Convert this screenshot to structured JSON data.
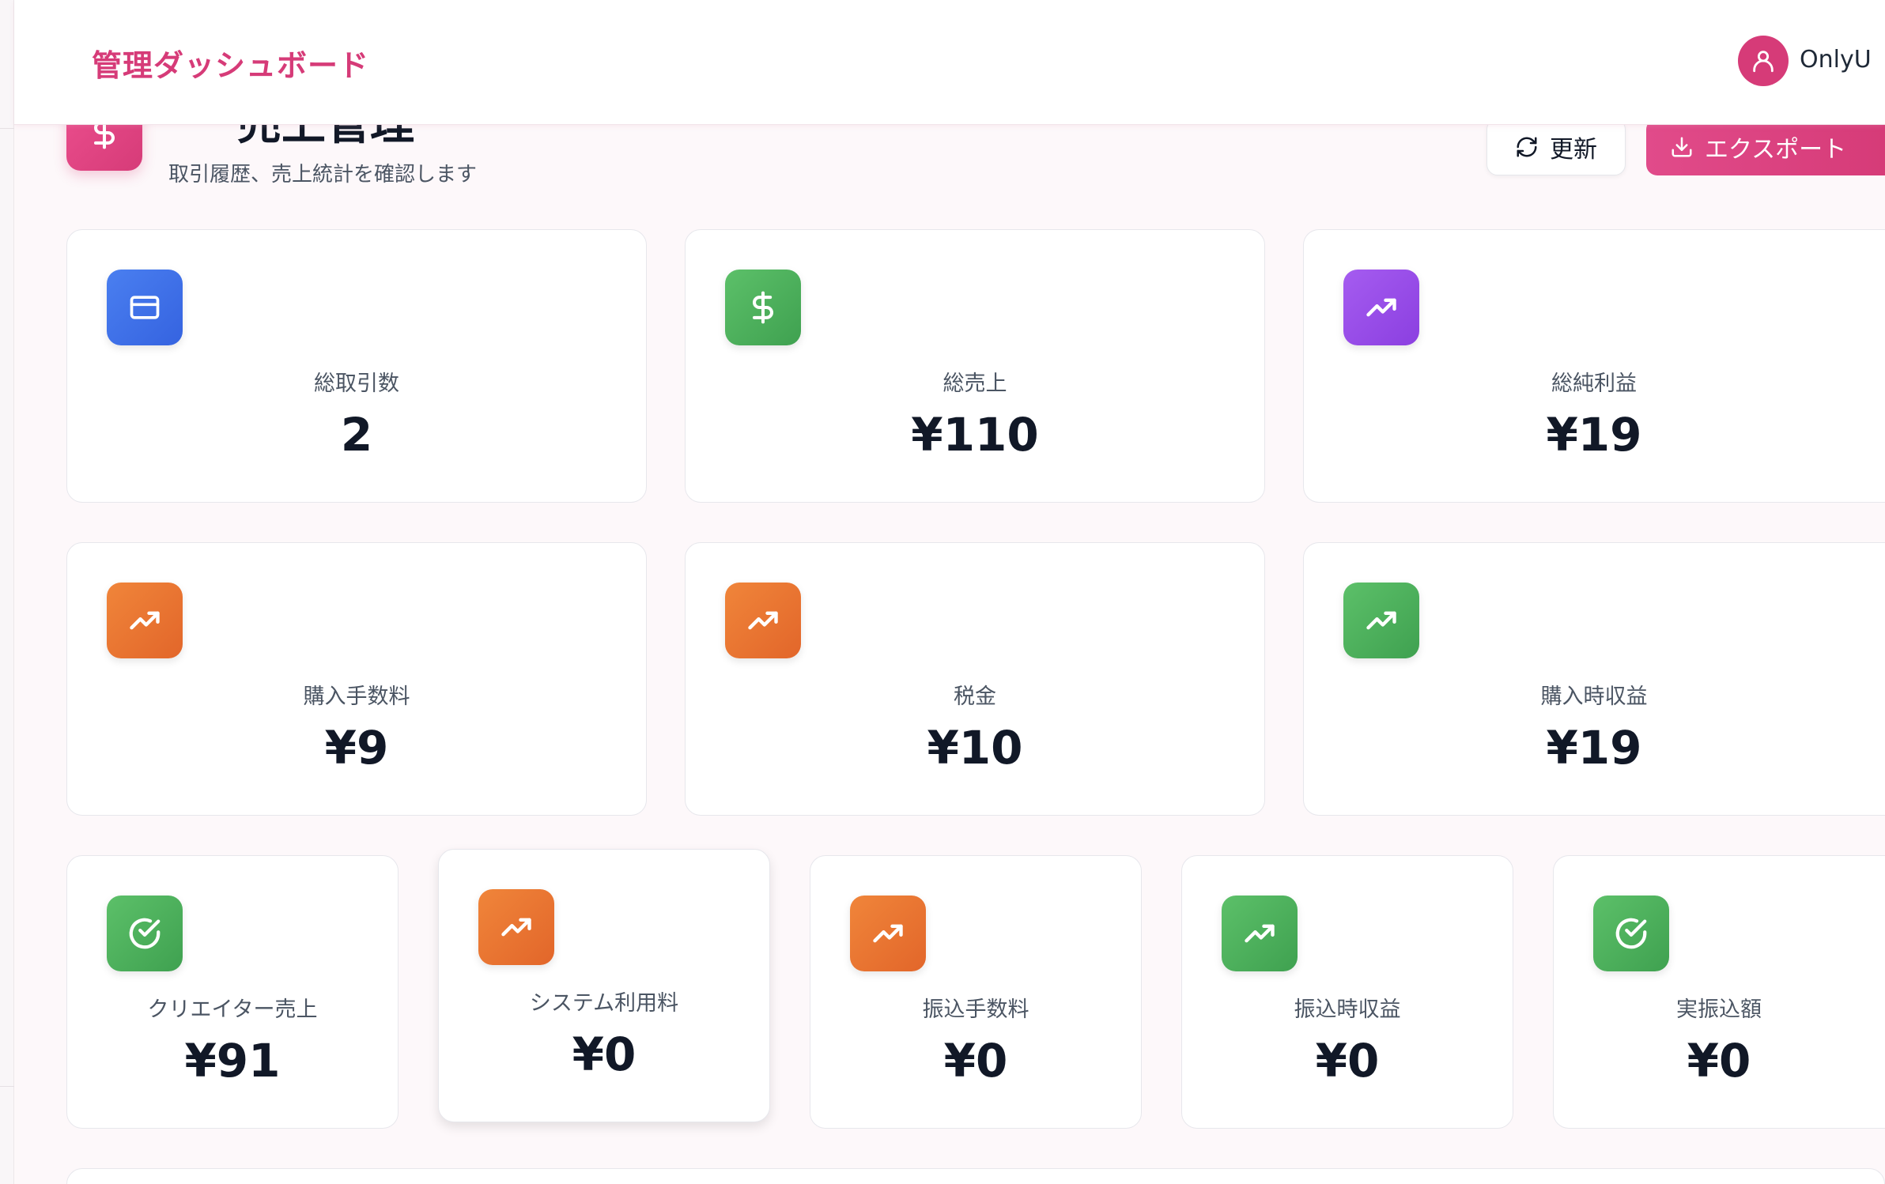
{
  "topbar": {
    "brand": "管理ダッシュボード",
    "username": "OnlyU"
  },
  "header": {
    "title": "売上管理",
    "subtitle": "取引履歴、売上統計を確認します",
    "refresh_label": "更新",
    "export_label": "エクスポート"
  },
  "stats_row1": [
    {
      "label": "総取引数",
      "value": "2",
      "icon": "credit-card-icon",
      "color": "#3b6ee6"
    },
    {
      "label": "総売上",
      "value": "¥110",
      "icon": "dollar-icon",
      "color": "#4caf5a"
    },
    {
      "label": "総純利益",
      "value": "¥19",
      "icon": "trending-up-icon",
      "color": "#9446e8"
    }
  ],
  "stats_row2": [
    {
      "label": "購入手数料",
      "value": "¥9",
      "icon": "trending-up-icon",
      "color": "#e8702f"
    },
    {
      "label": "税金",
      "value": "¥10",
      "icon": "trending-up-icon",
      "color": "#e8702f"
    },
    {
      "label": "購入時収益",
      "value": "¥19",
      "icon": "trending-up-icon",
      "color": "#4caf5a"
    }
  ],
  "stats_row3": [
    {
      "label": "クリエイター売上",
      "value": "¥91",
      "icon": "check-circle-icon",
      "color": "#4caf5a"
    },
    {
      "label": "システム利用料",
      "value": "¥0",
      "icon": "trending-up-icon",
      "color": "#e8702f"
    },
    {
      "label": "振込手数料",
      "value": "¥0",
      "icon": "trending-up-icon",
      "color": "#e8702f"
    },
    {
      "label": "振込時収益",
      "value": "¥0",
      "icon": "trending-up-icon",
      "color": "#4caf5a"
    },
    {
      "label": "実振込額",
      "value": "¥0",
      "icon": "check-circle-icon",
      "color": "#4caf5a"
    }
  ]
}
